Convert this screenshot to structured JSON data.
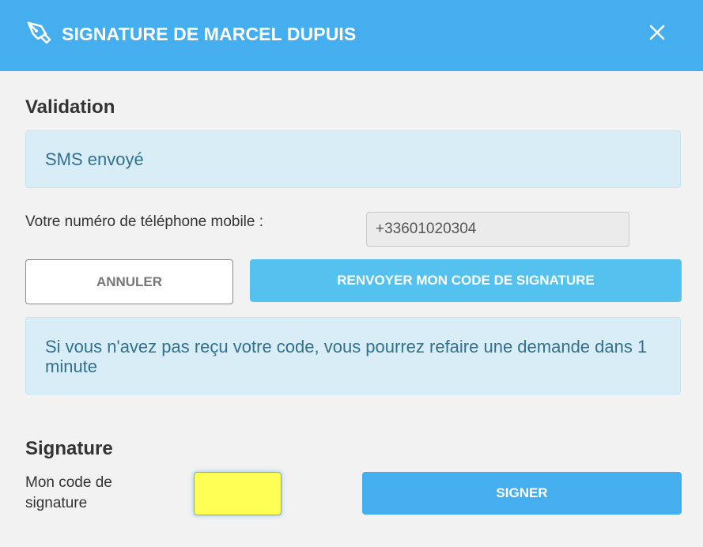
{
  "dialog": {
    "title": "SIGNATURE DE MARCEL DUPUIS",
    "icons": {
      "title": "pen-nib-icon",
      "close": "close-icon"
    },
    "colors": {
      "header": "#45aeef",
      "info_bg": "#d9edf7",
      "info_text": "#31708f",
      "primary": "#45aeef",
      "secondary": "#54c1ef",
      "code_field": "#ffff55"
    }
  },
  "validation": {
    "heading": "Validation",
    "sms_status": "SMS envoyé",
    "phone_label": "Votre numéro de téléphone mobile :",
    "phone_value": "+33601020304",
    "cancel_label": "ANNULER",
    "resend_label": "RENVOYER MON CODE DE SIGNATURE",
    "retry_notice": "Si vous n'avez pas reçu votre code, vous pourrez refaire une demande dans 1 minute"
  },
  "signature": {
    "heading": "Signature",
    "code_label": "Mon code de signature",
    "code_value": "",
    "sign_label": "SIGNER"
  }
}
